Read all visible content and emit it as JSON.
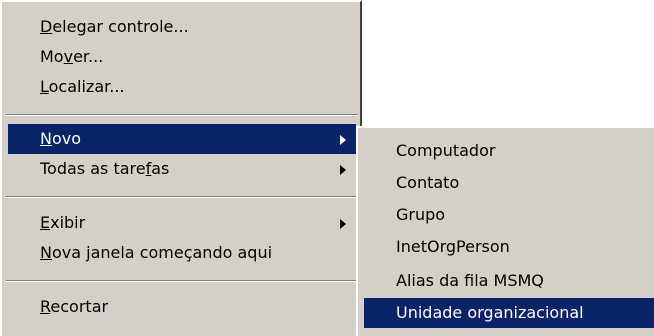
{
  "main_menu": {
    "items": [
      {
        "pre": "",
        "key": "D",
        "post": "elegar controle..."
      },
      {
        "pre": "Mo",
        "key": "v",
        "post": "er..."
      },
      {
        "pre": "",
        "key": "L",
        "post": "ocalizar..."
      },
      {
        "pre": "",
        "key": "N",
        "post": "ovo"
      },
      {
        "pre": "Todas as tare",
        "key": "f",
        "post": "as"
      },
      {
        "pre": "",
        "key": "E",
        "post": "xibir"
      },
      {
        "pre": "",
        "key": "N",
        "post": "ova janela começando aqui"
      },
      {
        "pre": "",
        "key": "R",
        "post": "ecortar"
      }
    ]
  },
  "sub_menu": {
    "items": [
      "Computador",
      "Contato",
      "Grupo",
      "InetOrgPerson",
      "Alias da fila MSMQ",
      "Unidade organizacional"
    ]
  },
  "colors": {
    "menu_bg": "#d4d0c8",
    "highlight_bg": "#0a246a",
    "highlight_text": "#ffffff"
  }
}
